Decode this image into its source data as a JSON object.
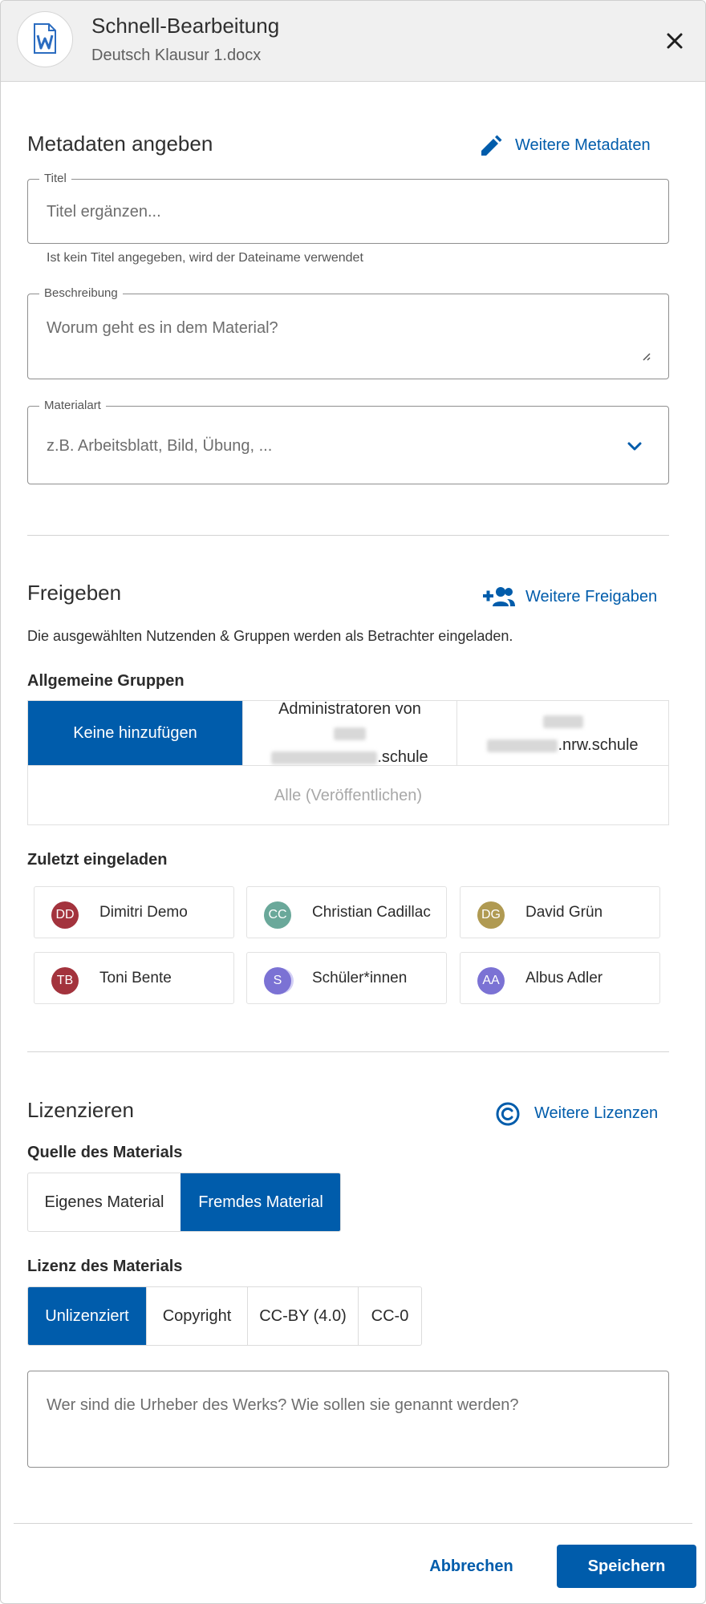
{
  "dialog": {
    "title": "Schnell-Bearbeitung",
    "filename": "Deutsch Klausur 1.docx",
    "file_icon": "word-document-icon",
    "close_icon": "close-icon"
  },
  "metadata": {
    "section_title": "Metadaten angeben",
    "more_link": "Weitere Metadaten",
    "more_icon": "pencil-icon",
    "title_field": {
      "label": "Titel",
      "value": "",
      "placeholder": "Titel ergänzen...",
      "hint": "Ist kein Titel angegeben, wird der Dateiname verwendet"
    },
    "description_field": {
      "label": "Beschreibung",
      "value": "",
      "placeholder": "Worum geht es in dem Material?"
    },
    "type_field": {
      "label": "Materialart",
      "placeholder": "z.B. Arbeitsblatt, Bild, Übung, ...",
      "icon": "chevron-down-icon"
    }
  },
  "sharing": {
    "section_title": "Freigeben",
    "more_link": "Weitere Freigaben",
    "more_icon": "add-person-icon",
    "info": "Die ausgewählten Nutzenden & Gruppen werden als Betrachter eingeladen.",
    "groups_title": "Allgemeine Gruppen",
    "group_options": [
      {
        "label": "Keine hinzufügen",
        "selected": true
      },
      {
        "line1": "Administratoren von",
        "suffix": ".schule",
        "selected": false
      },
      {
        "suffix": ".nrw.schule",
        "selected": false
      }
    ],
    "all_option": "Alle (Veröffentlichen)",
    "recent_title": "Zuletzt eingeladen",
    "recent": [
      {
        "initials": "DD",
        "name": "Dimitri Demo",
        "color": "#a3333d"
      },
      {
        "initials": "CC",
        "name": "Christian Cadillac",
        "color": "#6aa89a"
      },
      {
        "initials": "DG",
        "name": "David Grün",
        "color": "#b09a52"
      },
      {
        "initials": "TB",
        "name": "Toni Bente",
        "color": "#a3333d"
      },
      {
        "initials": "S",
        "name": "Schüler*innen",
        "color": "#7b72d4"
      },
      {
        "initials": "AA",
        "name": "Albus Adler",
        "color": "#7b72d4"
      }
    ]
  },
  "license": {
    "section_title": "Lizenzieren",
    "more_link": "Weitere Lizenzen",
    "more_icon": "copyright-icon",
    "source_title": "Quelle des Materials",
    "source_options": [
      {
        "label": "Eigenes Material",
        "selected": false
      },
      {
        "label": "Fremdes Material",
        "selected": true
      }
    ],
    "license_title": "Lizenz des Materials",
    "license_options": [
      {
        "label": "Unlizenziert",
        "selected": true
      },
      {
        "label": "Copyright",
        "selected": false
      },
      {
        "label": "CC-BY (4.0)",
        "selected": false
      },
      {
        "label": "CC-0",
        "selected": false
      }
    ],
    "author_placeholder": "Wer sind die Urheber des Werks? Wie sollen sie genannt werden?"
  },
  "footer": {
    "cancel": "Abbrechen",
    "save": "Speichern"
  },
  "colors": {
    "primary": "#005cab",
    "border": "#8f8f8f",
    "divider": "#d4d4d4",
    "header_bg": "#f0f0f0"
  }
}
